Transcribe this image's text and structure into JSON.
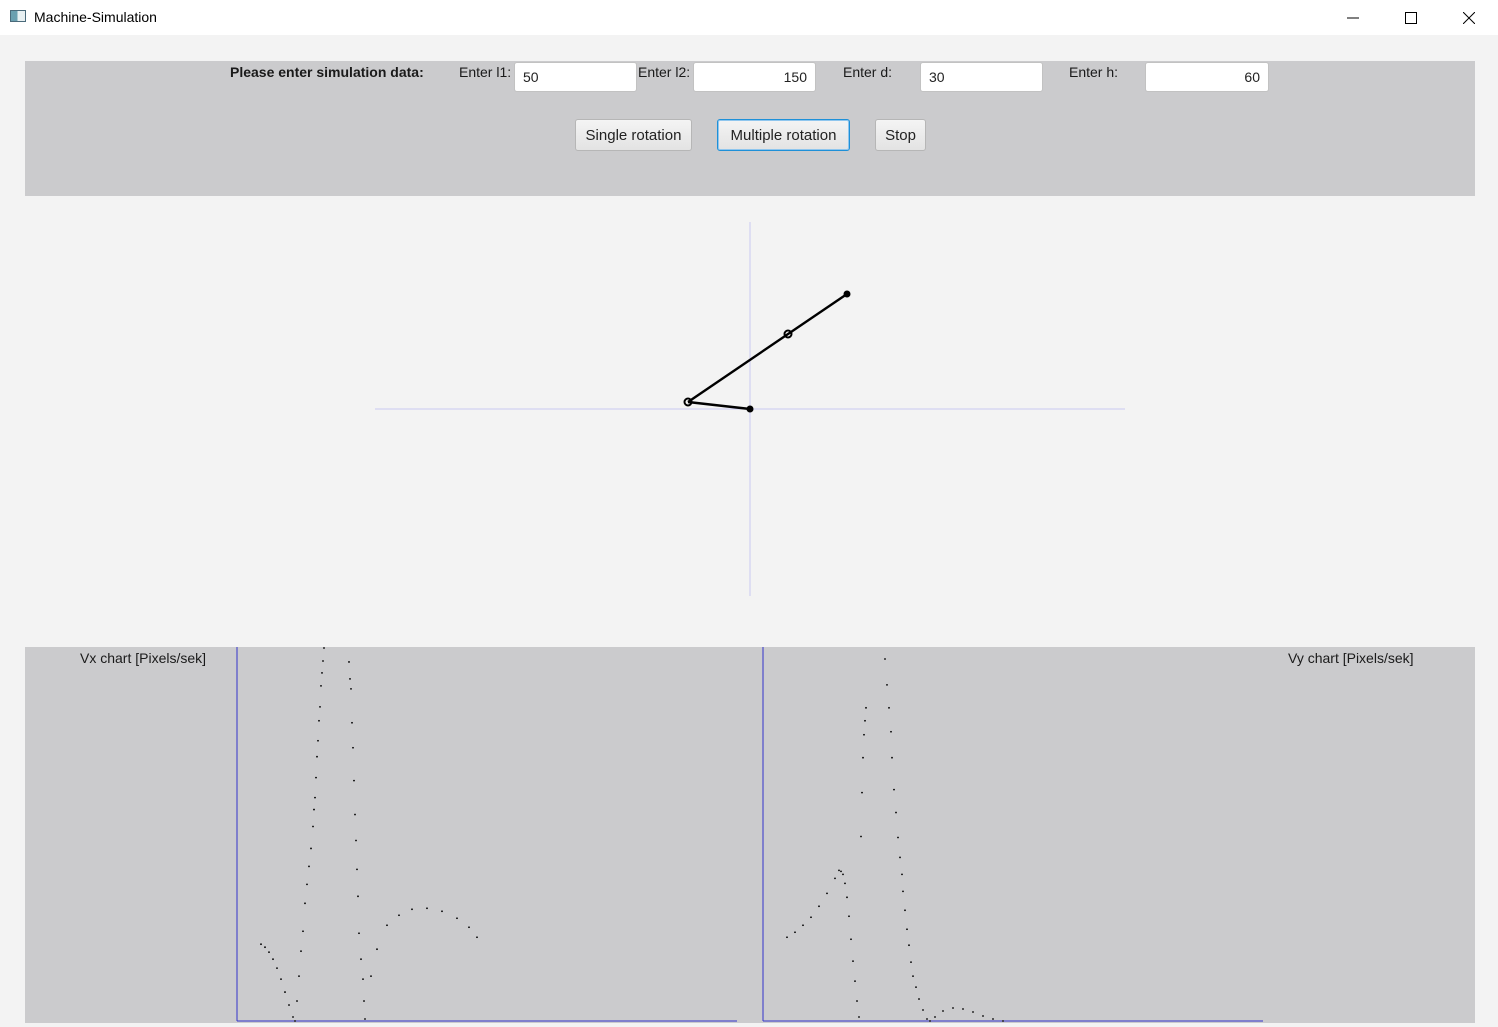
{
  "window": {
    "title": "Machine-Simulation",
    "controls": [
      "minimize-icon",
      "maximize-icon",
      "close-icon"
    ]
  },
  "form": {
    "heading": "Please enter simulation data:",
    "fields": [
      {
        "label": "Enter l1:",
        "value": "50"
      },
      {
        "label": "Enter l2:",
        "value": "150"
      },
      {
        "label": "Enter d:",
        "value": "30"
      },
      {
        "label": "Enter h:",
        "value": "60"
      }
    ]
  },
  "buttons": {
    "single": "Single rotation",
    "multiple": "Multiple rotation",
    "stop": "Stop"
  },
  "charts": {
    "vx_label": "Vx chart [Pixels/sek]",
    "vy_label": "Vy chart [Pixels/sek]"
  },
  "colors": {
    "panel": "#cbcbcd",
    "axis": "#3333cc",
    "guide": "#c8c8f0",
    "ink": "#000000"
  },
  "chart_data": [
    {
      "type": "scatter",
      "title": "Vx chart [Pixels/sek]",
      "xlabel": "",
      "ylabel": "",
      "xlim": [
        0,
        500
      ],
      "ylim": [
        0,
        375
      ],
      "series": [
        {
          "values": [
            [
              24,
              77
            ],
            [
              28,
              74
            ],
            [
              32,
              69
            ],
            [
              36,
              62
            ],
            [
              40,
              53
            ],
            [
              44,
              42
            ],
            [
              48,
              29
            ],
            [
              52,
              16
            ],
            [
              56,
              4
            ],
            [
              58,
              0
            ]
          ]
        },
        {
          "values": [
            [
              60,
              20
            ],
            [
              62,
              45
            ],
            [
              64,
              70
            ],
            [
              66,
              90
            ],
            [
              68,
              118
            ],
            [
              70,
              137
            ],
            [
              72,
              155
            ],
            [
              74,
              173
            ],
            [
              76,
              195
            ],
            [
              77,
              212
            ],
            [
              78,
              224
            ],
            [
              79,
              244
            ],
            [
              80,
              265
            ],
            [
              81,
              281
            ],
            [
              82,
              301
            ],
            [
              83,
              315
            ],
            [
              84,
              336
            ],
            [
              85,
              349
            ],
            [
              86,
              361
            ],
            [
              87,
              374
            ]
          ]
        },
        {
          "values": [
            [
              112,
              360
            ],
            [
              113,
              343
            ],
            [
              114,
              333
            ],
            [
              115,
              299
            ],
            [
              116,
              274
            ],
            [
              117,
              241
            ],
            [
              118,
              207
            ],
            [
              119,
              181
            ],
            [
              120,
              152
            ],
            [
              121,
              125
            ],
            [
              122,
              88
            ],
            [
              124,
              62
            ],
            [
              126,
              42
            ],
            [
              127,
              20
            ],
            [
              128,
              2
            ]
          ]
        },
        {
          "values": [
            [
              134,
              45
            ],
            [
              140,
              72
            ],
            [
              150,
              96
            ],
            [
              162,
              106
            ],
            [
              175,
              112
            ],
            [
              190,
              113
            ],
            [
              205,
              110
            ],
            [
              220,
              103
            ],
            [
              232,
              94
            ],
            [
              240,
              84
            ]
          ]
        }
      ]
    },
    {
      "type": "scatter",
      "title": "Vy chart [Pixels/sek]",
      "xlabel": "",
      "ylabel": "",
      "xlim": [
        0,
        500
      ],
      "ylim": [
        0,
        375
      ],
      "series": [
        {
          "values": [
            [
              24,
              84
            ],
            [
              32,
              89
            ],
            [
              40,
              96
            ],
            [
              48,
              104
            ],
            [
              56,
              115
            ],
            [
              64,
              128
            ],
            [
              72,
              143
            ],
            [
              76,
              151
            ],
            [
              78,
              150
            ]
          ]
        },
        {
          "values": [
            [
              80,
              147
            ],
            [
              82,
              138
            ],
            [
              84,
              124
            ],
            [
              86,
              105
            ],
            [
              88,
              82
            ],
            [
              90,
              60
            ],
            [
              92,
              40
            ],
            [
              94,
              20
            ],
            [
              96,
              4
            ]
          ]
        },
        {
          "values": [
            [
              98,
              185
            ],
            [
              99,
              229
            ],
            [
              100,
              264
            ],
            [
              101,
              287
            ],
            [
              102,
              301
            ],
            [
              103,
              314
            ]
          ]
        },
        {
          "values": [
            [
              122,
              363
            ],
            [
              124,
              337
            ],
            [
              126,
              314
            ],
            [
              128,
              290
            ],
            [
              129,
              264
            ],
            [
              131,
              232
            ],
            [
              133,
              209
            ],
            [
              135,
              184
            ],
            [
              137,
              164
            ],
            [
              139,
              147
            ],
            [
              140,
              130
            ],
            [
              142,
              111
            ],
            [
              144,
              92
            ],
            [
              146,
              76
            ],
            [
              148,
              59
            ],
            [
              150,
              45
            ],
            [
              153,
              34
            ],
            [
              156,
              22
            ],
            [
              160,
              11
            ],
            [
              164,
              2
            ],
            [
              167,
              0
            ],
            [
              172,
              4
            ],
            [
              180,
              10
            ],
            [
              190,
              13
            ],
            [
              200,
              12
            ],
            [
              210,
              9
            ],
            [
              220,
              5
            ],
            [
              230,
              2
            ],
            [
              240,
              0
            ]
          ]
        }
      ]
    }
  ]
}
